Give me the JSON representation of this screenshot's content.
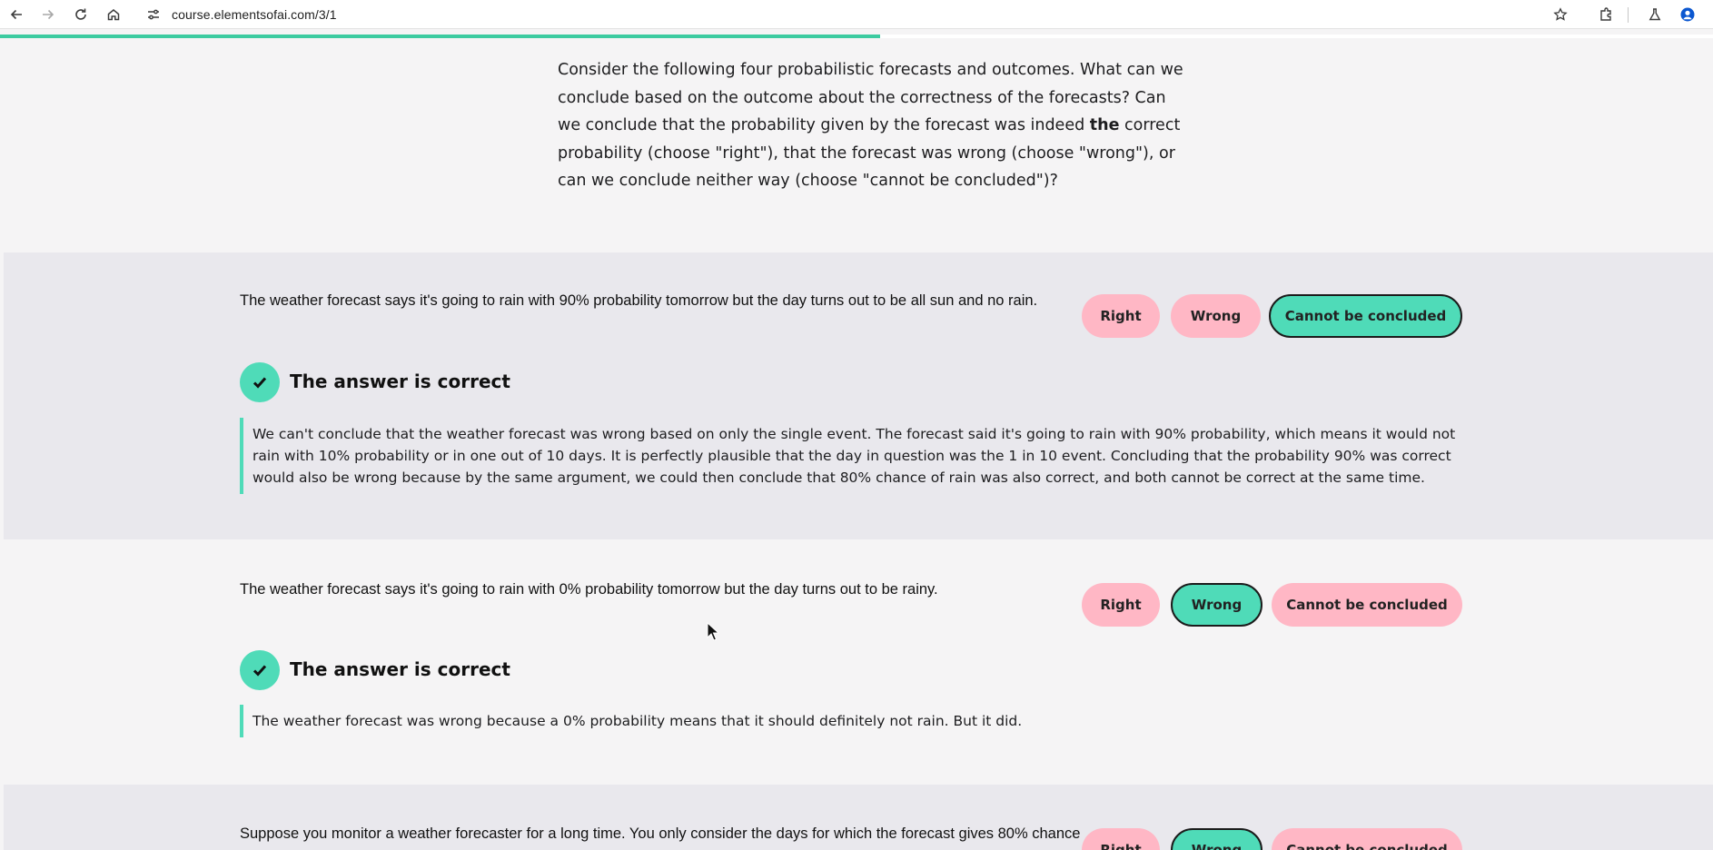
{
  "browser": {
    "url": "course.elementsofai.com/3/1",
    "icons": [
      "back-icon",
      "forward-icon",
      "reload-icon",
      "home-icon",
      "site-info-icon",
      "bookmark-star-icon",
      "extensions-icon",
      "labs-icon",
      "profile-icon"
    ]
  },
  "progress": {
    "fraction": 0.514,
    "color": "#3ccba0"
  },
  "intro": {
    "text_before": "Consider the following four probabilistic forecasts and outcomes. What can we conclude based on the outcome about the correctness of the forecasts? Can we conclude that the probability given by the forecast was indeed ",
    "emphasis": "the",
    "text_after": " correct probability (choose \"right\"), that the forecast was wrong (choose \"wrong\"), or can we conclude neither way (choose \"cannot be concluded\")?"
  },
  "options": {
    "right": "Right",
    "wrong": "Wrong",
    "cannot": "Cannot be concluded"
  },
  "colors": {
    "selected": "#4fdbb8",
    "unselected": "#ffb7c5",
    "shaded_bg": "#e9e8ed",
    "page_bg": "#f5f4f5"
  },
  "exercises": [
    {
      "question": "The weather forecast says it's going to rain with 90% probability tomorrow but the day turns out to be all sun and no rain.",
      "selected": "cannot",
      "feedback_title": "The answer is correct",
      "explanation": "We can't conclude that the weather forecast was wrong based on only the single event. The forecast said it's going to rain with 90% probability, which means it would not rain with 10% probability or in one out of 10 days. It is perfectly plausible that the day in question was the 1 in 10 event. Concluding that the probability 90% was correct would also be wrong because by the same argument, we could then conclude that 80% chance of rain was also correct, and both cannot be correct at the same time."
    },
    {
      "question": "The weather forecast says it's going to rain with 0% probability tomorrow but the day turns out to be rainy.",
      "selected": "wrong",
      "feedback_title": "The answer is correct",
      "explanation": "The weather forecast was wrong because a 0% probability means that it should definitely not rain. But it did."
    },
    {
      "question": "Suppose you monitor a weather forecaster for a long time. You only consider the days for which the forecast gives 80% chance",
      "selected": "wrong"
    }
  ]
}
